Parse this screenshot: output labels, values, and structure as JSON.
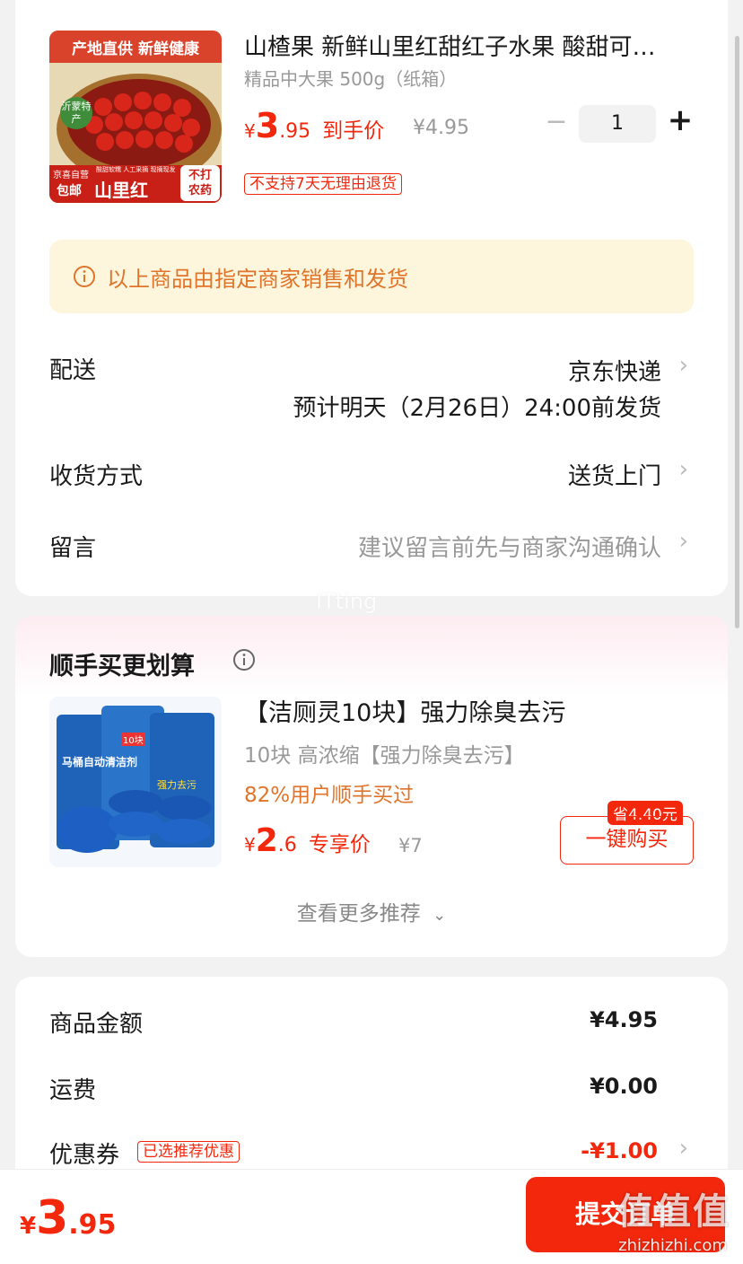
{
  "product": {
    "title": "山楂果 新鲜山里红甜红子水果 酸甜可…",
    "spec": "精品中大果 500g（纸箱）",
    "price_symbol": "¥",
    "price_int": "3",
    "price_dec": ".95",
    "price_label": "到手价",
    "original_price": "¥4.95",
    "qty": "1",
    "qty_minus": "−",
    "qty_plus": "+",
    "no_return_tag": "不支持7天无理由退货",
    "image_texts": {
      "banner": "产地直供 新鲜健康",
      "origin": "沂蒙特产",
      "brand": "京喜自营",
      "free_ship": "包邮",
      "name": "山里红",
      "no_pesticide": "不打农药",
      "small": "酸甜软糯 人工采摘 现摘现发"
    }
  },
  "notice": {
    "icon": "info-icon",
    "text": "以上商品由指定商家销售和发货"
  },
  "delivery": {
    "label": "配送",
    "carrier": "京东快递",
    "eta": "预计明天（2月26日）24:00前发货"
  },
  "receive": {
    "label": "收货方式",
    "value": "送货上门"
  },
  "message": {
    "label": "留言",
    "placeholder": "建议留言前先与商家沟通确认"
  },
  "watermark_mid": "ITting",
  "recommend": {
    "title": "顺手买更划算",
    "item": {
      "title": "【洁厕灵10块】强力除臭去污",
      "spec": "10块 高浓缩【强力除臭去污】",
      "bought": "82%用户顺手买过",
      "price_symbol": "¥",
      "price_int": "2",
      "price_dec": ".6",
      "price_label": "专享价",
      "original_price": "¥7",
      "save_badge": "省4.40元",
      "buy_button": "一键购买",
      "image_texts": {
        "pack": "马桶自动清洁剂",
        "pack2": "强力去污",
        "count": "10块"
      }
    },
    "more": "查看更多推荐"
  },
  "summary": {
    "rows": [
      {
        "label": "商品金额",
        "value": "¥4.95"
      },
      {
        "label": "运费",
        "value": "¥0.00"
      },
      {
        "label": "优惠券",
        "tag": "已选推荐优惠",
        "value": "-¥1.00"
      }
    ]
  },
  "footer": {
    "price_symbol": "¥",
    "price_int": "3",
    "price_dec": ".95",
    "submit": "提交订单"
  },
  "watermark": {
    "brand": "值值值",
    "site": "zhizhizhi.com"
  },
  "colors": {
    "accent": "#f2270c",
    "notice_bg": "#fdf6dc",
    "submit_bg": "#f2270c"
  }
}
